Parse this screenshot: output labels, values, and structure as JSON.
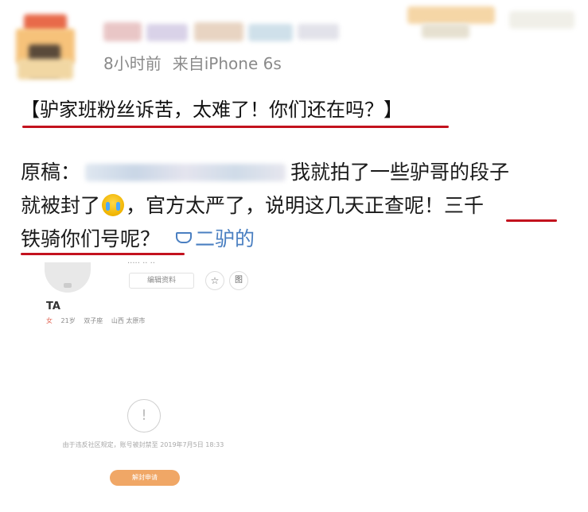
{
  "post": {
    "meta_time": "8小时前",
    "meta_source": "来自iPhone 6s",
    "title": "【驴家班粉丝诉苦，太难了！你们还在吗？】",
    "line1_prefix": "原稿：",
    "line1_suffix": "我就拍了一些驴哥的段子",
    "line2_part1": "就被封了",
    "line2_part2": "，官方太严了，说明这几天正查呢！",
    "line2_highlight": "三千",
    "line3_highlight": "铁骑你们号呢？",
    "topic_link": "二驴的"
  },
  "embedded_profile": {
    "header_small": "····· ·· ··",
    "edit_button": "编辑资料",
    "star_icon": "☆",
    "profile_icon": "图",
    "name": "TA",
    "tags": [
      "女",
      "21岁",
      "双子座",
      "山西 太原市"
    ],
    "warning_icon": "!",
    "notice": "由于违反社区规定，账号被封禁至 2019年7月5日 18:33",
    "appeal_button": "解封申请"
  },
  "colors": {
    "underline_red": "#c3121e",
    "link_blue": "#4a7fc1",
    "meta_gray": "#8a8a8a",
    "appeal_orange": "#f0a766"
  },
  "icons": [
    "avatar",
    "crying-emoji-icon",
    "diamond-topic-icon",
    "star-icon",
    "profile-icon",
    "warning-icon"
  ]
}
